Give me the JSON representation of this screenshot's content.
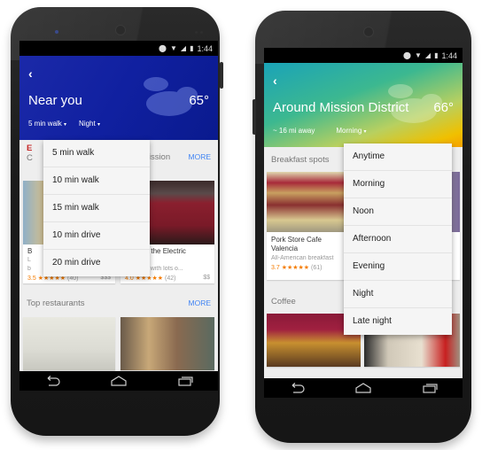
{
  "left_phone": {
    "status": {
      "time": "1:44",
      "icons": [
        "location-icon",
        "wifi-icon",
        "signal-icon",
        "battery-icon"
      ]
    },
    "hero": {
      "back": "‹",
      "title": "Near you",
      "temperature": "65°",
      "weather": "cloudy",
      "filter_distance": "5 min walk",
      "filter_time": "Night",
      "caret": "▾"
    },
    "section1": {
      "title_partial": "C",
      "title_suffix": "e Mission",
      "more": "MORE",
      "badge_letter": "E",
      "cards": [
        {
          "name": "B",
          "desc": "L",
          "desc2": "b",
          "rating": "3.5",
          "stars": "★★★★★",
          "count": "(40)",
          "price": "$$$"
        },
        {
          "name": "Teeth & the Electric Hyhem",
          "name_line1": "Teeth & the Electric",
          "name_line2": "Hyhem",
          "desc": "back bar with lots o...",
          "rating": "4.0",
          "stars": "★★★★★",
          "count": "(42)",
          "price": "$$"
        }
      ]
    },
    "section2": {
      "title": "Top restaurants",
      "more": "MORE"
    },
    "dropdown": {
      "options": [
        "5 min walk",
        "10 min walk",
        "15 min walk",
        "10 min drive",
        "20 min drive"
      ]
    },
    "navbar": [
      "back-icon",
      "home-icon",
      "recents-icon"
    ]
  },
  "right_phone": {
    "status": {
      "time": "1:44",
      "icons": [
        "location-icon",
        "wifi-icon",
        "signal-icon",
        "battery-icon"
      ]
    },
    "hero": {
      "back": "‹",
      "title": "Around Mission District",
      "temperature": "66°",
      "weather": "cloudy",
      "filter_distance": "~ 16 mi away",
      "filter_time": "Morning",
      "caret": "▾"
    },
    "section1": {
      "title": "Breakfast spots",
      "cards": [
        {
          "name_line1": "Pork Store Cafe",
          "name_line2": "Valencia",
          "desc": "All-American breakfast",
          "rating": "3.7",
          "stars": "★★★★★",
          "count": "(61)"
        }
      ]
    },
    "section2": {
      "title": "Coffee"
    },
    "dropdown": {
      "options": [
        "Anytime",
        "Morning",
        "Noon",
        "Afternoon",
        "Evening",
        "Night",
        "Late night"
      ]
    },
    "navbar": [
      "back-icon",
      "home-icon",
      "recents-icon"
    ]
  }
}
